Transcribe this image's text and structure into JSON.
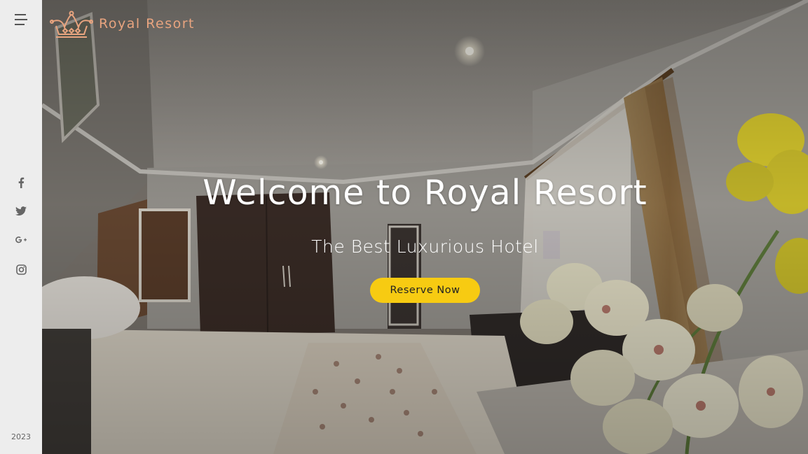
{
  "brand": {
    "name": "Royal Resort",
    "logo_icon": "crown-icon",
    "accent": "#e8a47f"
  },
  "sidebar": {
    "menu_icon": "hamburger-icon",
    "socials": [
      {
        "name": "facebook",
        "icon": "facebook-icon"
      },
      {
        "name": "twitter",
        "icon": "twitter-icon"
      },
      {
        "name": "google-plus",
        "icon": "google-plus-icon"
      },
      {
        "name": "instagram",
        "icon": "instagram-icon"
      }
    ],
    "year": "2023"
  },
  "hero": {
    "title": "Welcome to Royal Resort",
    "subtitle": "The Best Luxurious Hotel",
    "cta_label": "Reserve Now",
    "cta_color": "#f7cb12"
  }
}
